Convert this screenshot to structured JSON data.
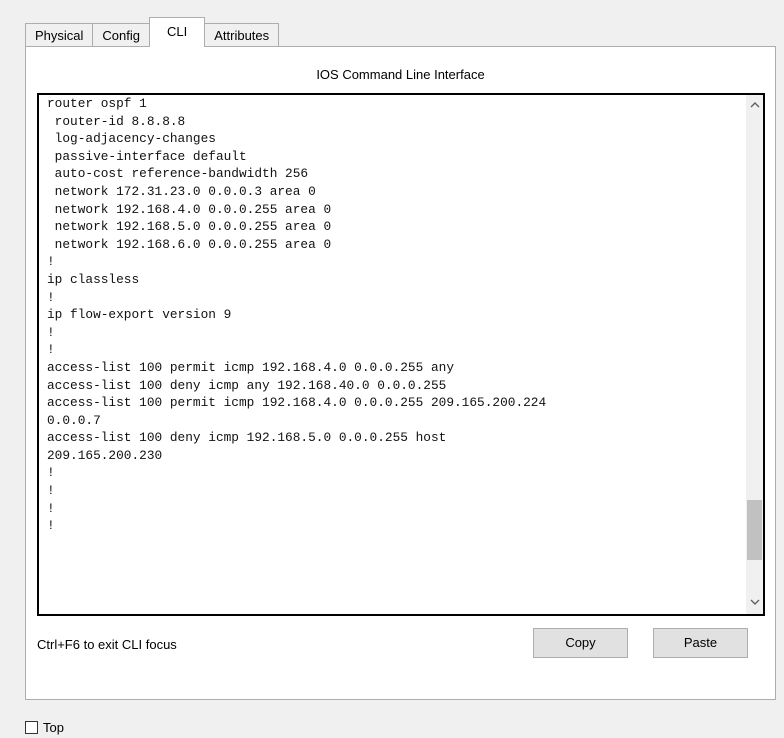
{
  "tabs": [
    "Physical",
    "Config",
    "CLI",
    "Attributes"
  ],
  "active_tab": "CLI",
  "panel_title": "IOS Command Line Interface",
  "cli_text": "router ospf 1\n router-id 8.8.8.8\n log-adjacency-changes\n passive-interface default\n auto-cost reference-bandwidth 256\n network 172.31.23.0 0.0.0.3 area 0\n network 192.168.4.0 0.0.0.255 area 0\n network 192.168.5.0 0.0.0.255 area 0\n network 192.168.6.0 0.0.0.255 area 0\n!\nip classless\n!\nip flow-export version 9\n!\n!\naccess-list 100 permit icmp 192.168.4.0 0.0.0.255 any\naccess-list 100 deny icmp any 192.168.40.0 0.0.0.255\naccess-list 100 permit icmp 192.168.4.0 0.0.0.255 209.165.200.224\n0.0.0.7\naccess-list 100 deny icmp 192.168.5.0 0.0.0.255 host\n209.165.200.230\n!\n!\n!\n!",
  "hint": "Ctrl+F6 to exit CLI focus",
  "buttons": {
    "copy": "Copy",
    "paste": "Paste"
  },
  "top_checkbox": {
    "label": "Top",
    "checked": false
  },
  "scroll_icons": {
    "up": "chevron-up-icon",
    "down": "chevron-down-icon"
  }
}
